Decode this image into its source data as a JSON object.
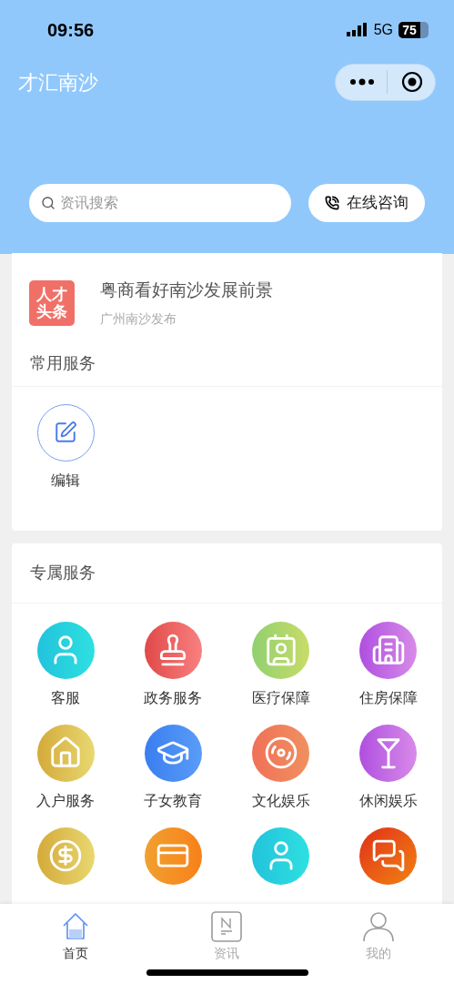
{
  "status_bar": {
    "time": "09:56",
    "network": "5G",
    "battery": "75"
  },
  "header": {
    "title": "才汇南沙"
  },
  "search": {
    "placeholder": "资讯搜索"
  },
  "consult_button": {
    "label": "在线咨询"
  },
  "headline": {
    "badge_line_1": "人才",
    "badge_line_2": "头条",
    "title": "粤商看好南沙发展前景",
    "source": "广州南沙发布"
  },
  "common_services": {
    "title": "常用服务",
    "items": [
      {
        "kind": "edit",
        "label": "编辑"
      }
    ]
  },
  "exclusive_services": {
    "title": "专属服务",
    "items": [
      {
        "kind": "agent",
        "label": "客服"
      },
      {
        "kind": "stamp",
        "label": "政务服务"
      },
      {
        "kind": "card",
        "label": "医疗保障"
      },
      {
        "kind": "building",
        "label": "住房保障"
      },
      {
        "kind": "house",
        "label": "入户服务"
      },
      {
        "kind": "cap",
        "label": "子女教育"
      },
      {
        "kind": "music",
        "label": "文化娱乐"
      },
      {
        "kind": "cocktail",
        "label": "休闲娱乐"
      },
      {
        "kind": "dollar"
      },
      {
        "kind": "bankcard"
      },
      {
        "kind": "agent"
      },
      {
        "kind": "chat"
      }
    ]
  },
  "tab_bar": [
    {
      "kind": "home",
      "label": "首页",
      "selected": true
    },
    {
      "kind": "news",
      "label": "资讯",
      "selected": false
    },
    {
      "kind": "profile",
      "label": "我的",
      "selected": false
    }
  ]
}
